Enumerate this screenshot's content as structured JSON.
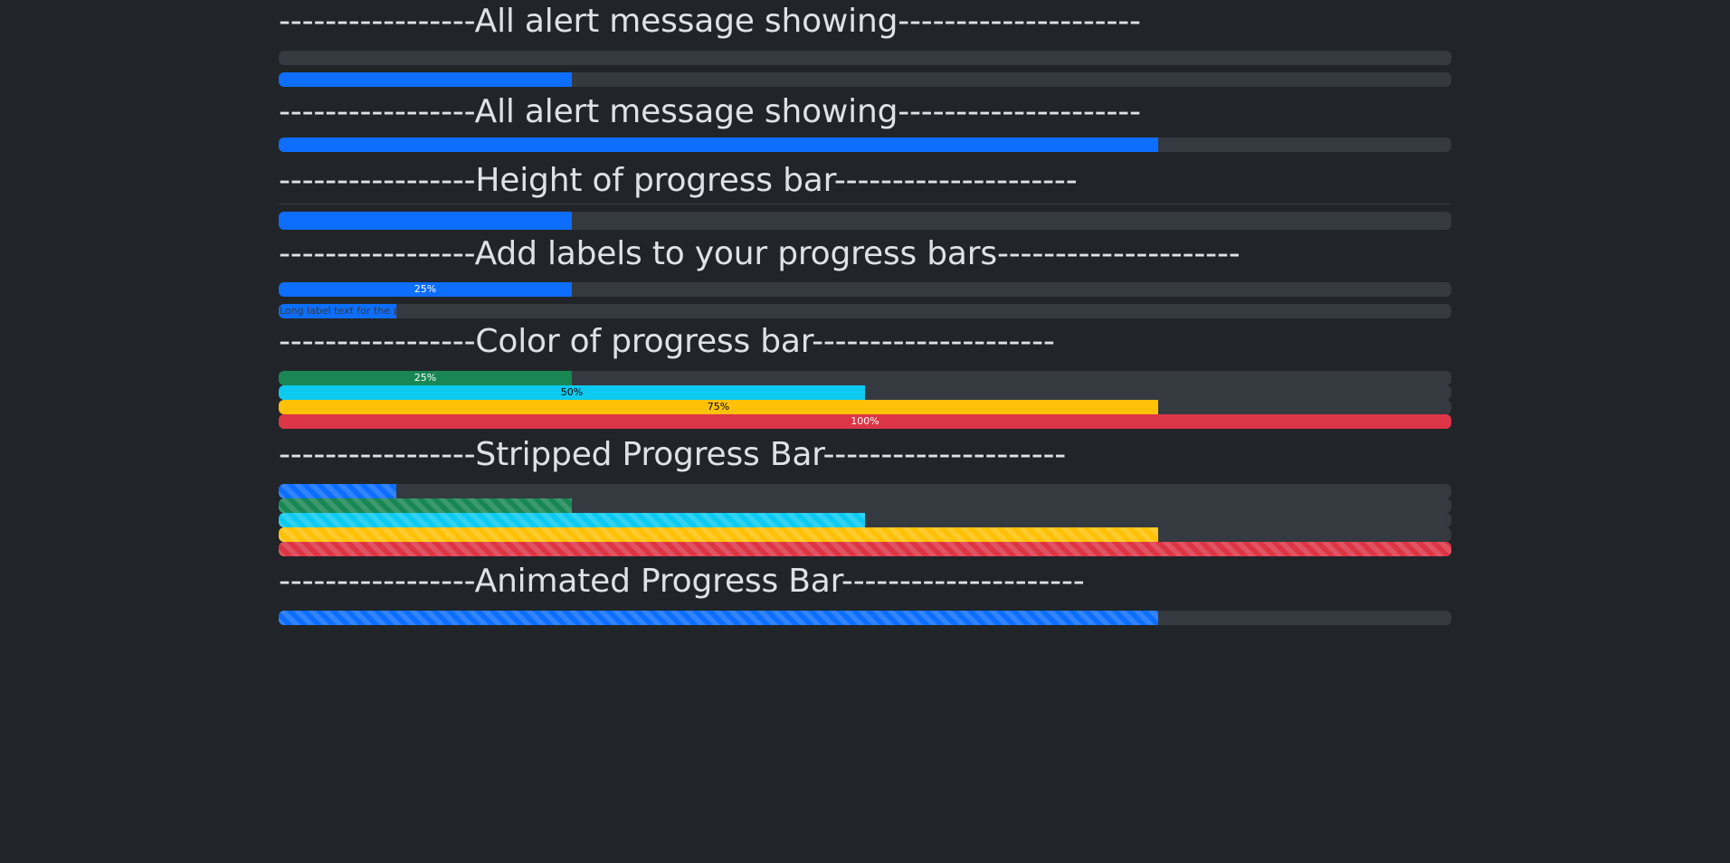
{
  "headings": {
    "alert1": "-----------------All alert message showing---------------------",
    "alert2": "-----------------All alert message showing---------------------",
    "height": "-----------------Height of progress bar---------------------",
    "labels": "-----------------Add labels to your progress bars---------------------",
    "color": "-----------------Color of progress bar---------------------",
    "striped": "-----------------Stripped Progress Bar---------------------",
    "animated": "-----------------Animated Progress Bar---------------------"
  },
  "progress": {
    "basic_empty": 0,
    "basic_25": 25,
    "basic_75": 75,
    "height_25": 25,
    "label_25": {
      "value": 25,
      "label": "25%"
    },
    "long_label": {
      "value": 10,
      "label": "Long label text for the progress bar, set to a dark color"
    },
    "colors": [
      {
        "variant": "success",
        "value": 25,
        "label": "25%",
        "color": "#198754"
      },
      {
        "variant": "info",
        "value": 50,
        "label": "50%",
        "color": "#0dcaf0"
      },
      {
        "variant": "warning",
        "value": 75,
        "label": "75%",
        "color": "#ffc107"
      },
      {
        "variant": "danger",
        "value": 100,
        "label": "100%",
        "color": "#dc3545"
      }
    ],
    "striped": [
      {
        "variant": "primary",
        "value": 10,
        "color": "#0d6efd"
      },
      {
        "variant": "success",
        "value": 25,
        "color": "#198754"
      },
      {
        "variant": "info",
        "value": 50,
        "color": "#0dcaf0"
      },
      {
        "variant": "warning",
        "value": 75,
        "color": "#ffc107"
      },
      {
        "variant": "danger",
        "value": 100,
        "color": "#dc3545"
      }
    ],
    "animated": {
      "variant": "primary",
      "value": 75,
      "color": "#0d6efd"
    }
  },
  "theme": {
    "background": "#212529",
    "track": "#343a40",
    "primary": "#0d6efd"
  }
}
